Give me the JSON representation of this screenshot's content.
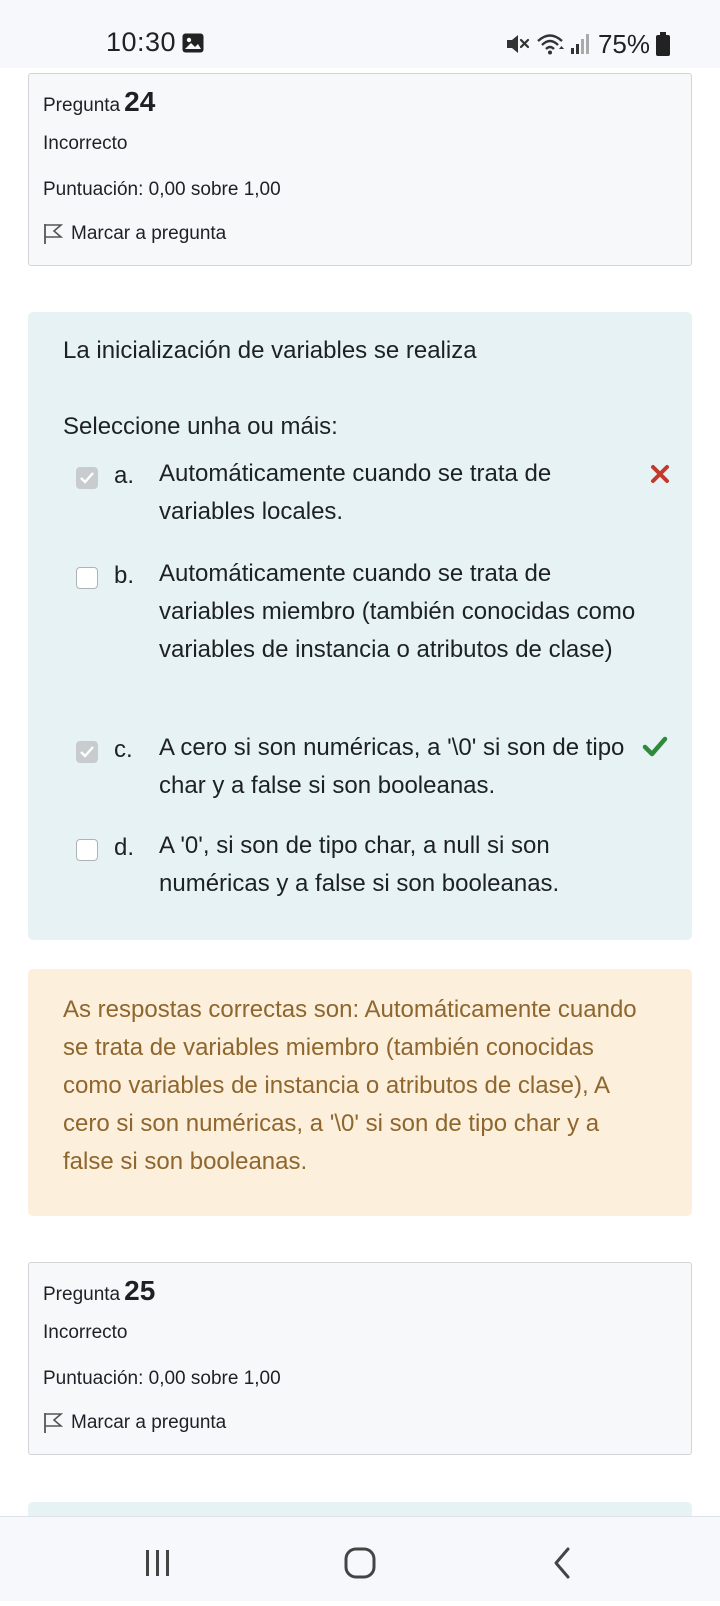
{
  "status_bar": {
    "time": "10:30",
    "battery": "75%",
    "icons": [
      "image-icon",
      "mute-icon",
      "wifi-icon",
      "signal-icon",
      "battery-icon"
    ]
  },
  "question_24": {
    "label": "Pregunta",
    "number": "24",
    "state": "Incorrecto",
    "grade": "Puntuación: 0,00 sobre 1,00",
    "flag_label": "Marcar a pregunta"
  },
  "question_content": {
    "text": "La inicialización de variables se realiza",
    "prompt": "Seleccione unha ou máis:",
    "options": [
      {
        "letter": "a.",
        "text": "Automáticamente cuando se trata de variables locales.",
        "checked": true,
        "mark": "incorrect"
      },
      {
        "letter": "b.",
        "text": "Automáticamente cuando se trata de variables miembro (también conocidas como variables de instancia o atributos de clase)",
        "checked": false,
        "mark": ""
      },
      {
        "letter": "c.",
        "text": "A cero si son numéricas, a '\\0' si son de tipo char y a false si son booleanas.",
        "checked": true,
        "mark": "correct"
      },
      {
        "letter": "d.",
        "text": "A '0', si son de tipo char, a null si son numéricas y a false si son booleanas.",
        "checked": false,
        "mark": ""
      }
    ]
  },
  "feedback": {
    "text": "As respostas correctas son: Automáticamente cuando se trata de variables miembro (también conocidas como variables de instancia o atributos de clase), A cero si son numéricas, a '\\0' si son de tipo char y a false si son booleanas."
  },
  "question_25": {
    "label": "Pregunta",
    "number": "25",
    "state": "Incorrecto",
    "grade": "Puntuación: 0,00 sobre 1,00",
    "flag_label": "Marcar a pregunta"
  },
  "colors": {
    "question_bg": "#e7f2f4",
    "feedback_bg": "#fcefdc",
    "feedback_text": "#8e662e",
    "correct": "#2f8a3b",
    "incorrect": "#c23a2b"
  }
}
